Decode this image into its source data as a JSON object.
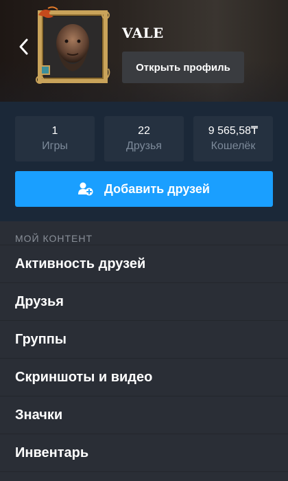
{
  "header": {
    "username": "VALE",
    "open_profile_label": "Открыть профиль"
  },
  "stats": [
    {
      "value": "1",
      "label": "Игры"
    },
    {
      "value": "22",
      "label": "Друзья"
    },
    {
      "value": "9 565,58₸",
      "label": "Кошелёк"
    }
  ],
  "add_friends": {
    "label": "Добавить друзей",
    "icon": "add-user-icon"
  },
  "content": {
    "section_title": "МОЙ КОНТЕНТ",
    "items": [
      {
        "label": "Активность друзей"
      },
      {
        "label": "Друзья"
      },
      {
        "label": "Группы"
      },
      {
        "label": "Скриншоты и видео"
      },
      {
        "label": "Значки"
      },
      {
        "label": "Инвентарь"
      }
    ]
  },
  "colors": {
    "background": "#1b2838",
    "accent": "#1a9fff",
    "stat_tile": "#253140",
    "content_bg": "#2a2e36"
  }
}
